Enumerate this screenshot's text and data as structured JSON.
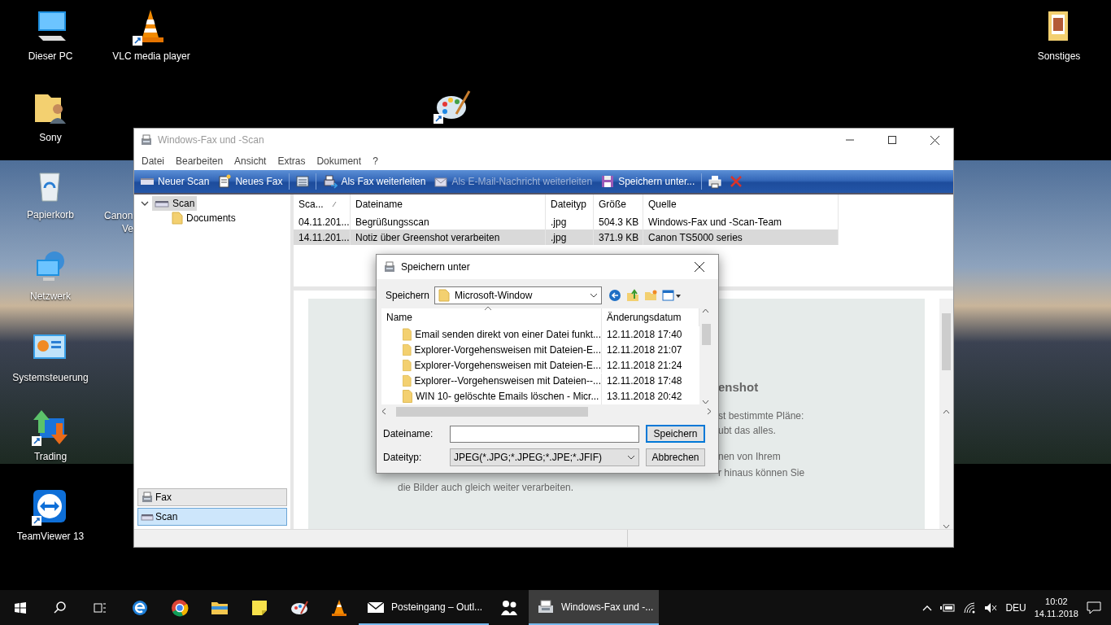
{
  "desktop": {
    "icons": [
      {
        "kind": "icon",
        "label": "Dieser PC",
        "shortcut": false
      },
      {
        "kind": "icon",
        "label": "VLC media player",
        "shortcut": true
      },
      {
        "kind": "icon",
        "label": "Sony",
        "shortcut": false
      },
      {
        "kind": "icon",
        "shortcut": true
      },
      {
        "kind": "icon",
        "label": "Papierkorb",
        "shortcut": false
      },
      {
        "kind": "cut",
        "lines": [
          "Canon",
          "Ve"
        ]
      },
      {
        "kind": "icon",
        "label": "Netzwerk",
        "shortcut": false
      },
      {
        "kind": "icon",
        "label": "Systemsteuerung",
        "shortcut": false
      },
      {
        "kind": "icon",
        "label": "Trading",
        "shortcut": true
      },
      {
        "kind": "icon",
        "label": "TeamViewer 13",
        "shortcut": true
      },
      {
        "kind": "icon",
        "label": "Sonstiges",
        "shortcut": false
      }
    ]
  },
  "window": {
    "title": "Windows-Fax und -Scan",
    "menu": [
      "Datei",
      "Bearbeiten",
      "Ansicht",
      "Extras",
      "Dokument",
      "?"
    ],
    "toolbar": [
      {
        "kind": "button",
        "label": "Neuer Scan",
        "disabled": false
      },
      {
        "kind": "button",
        "label": "Neues Fax",
        "disabled": false
      },
      {
        "kind": "separator"
      },
      {
        "kind": "icon",
        "disabled": false
      },
      {
        "kind": "separator"
      },
      {
        "kind": "button",
        "label": "Als Fax weiterleiten",
        "disabled": false
      },
      {
        "kind": "button",
        "label": "Als E-Mail-Nachricht weiterleiten",
        "disabled": true
      },
      {
        "kind": "button",
        "label": "Speichern unter...",
        "disabled": false
      },
      {
        "kind": "separator"
      },
      {
        "kind": "icon",
        "disabled": false
      },
      {
        "kind": "icon",
        "disabled": false
      }
    ],
    "tree": [
      {
        "label": "Scan",
        "expanded": true,
        "selected": true,
        "children": [
          {
            "label": "Documents"
          }
        ]
      }
    ],
    "nav_buttons": [
      {
        "label": "Fax",
        "selected": false
      },
      {
        "label": "Scan",
        "selected": true
      }
    ],
    "table": {
      "columns": [
        "Sca...",
        "Dateiname",
        "Dateityp",
        "Größe",
        "Quelle"
      ],
      "rows": [
        {
          "cells": [
            "04.11.201...",
            "Begrüßungsscan",
            ".jpg",
            "504.3 KB",
            "Windows-Fax und -Scan-Team"
          ],
          "selected": false
        },
        {
          "cells": [
            "14.11.201...",
            "Notiz über Greenshot verarbeiten",
            ".jpg",
            "371.9 KB",
            "Canon TS5000 series"
          ],
          "selected": true
        }
      ]
    },
    "preview": {
      "lines": [
        {
          "kind": "heading",
          "text": "enshot"
        },
        {
          "kind": "body",
          "text": "st bestimmte Pläne:"
        },
        {
          "kind": "body",
          "text": "ubt das alles."
        },
        {
          "kind": "body",
          "text": "nen von Ihrem"
        },
        {
          "kind": "body",
          "text": "r hinaus können Sie"
        },
        {
          "kind": "body",
          "text": "die Bilder auch gleich weiter verarbeiten."
        }
      ]
    }
  },
  "dialog": {
    "title": "Speichern unter",
    "save_in": {
      "label": "Speichern",
      "value": "Microsoft-Window"
    },
    "columns": [
      "Name",
      "Änderungsdatum"
    ],
    "rows": [
      {
        "name": "Email senden direkt von einer Datei funkt...",
        "date": "12.11.2018 17:40"
      },
      {
        "name": "Explorer-Vorgehensweisen mit Dateien-E...",
        "date": "12.11.2018 21:07"
      },
      {
        "name": "Explorer-Vorgehensweisen mit Dateien-E...",
        "date": "12.11.2018 21:24"
      },
      {
        "name": "Explorer--Vorgehensweisen mit Dateien--...",
        "date": "12.11.2018 17:48"
      },
      {
        "name": "WIN 10- gelöschte Emails löschen - Micr...",
        "date": "13.11.2018 20:42"
      }
    ],
    "filename": {
      "label": "Dateiname:"
    },
    "filetype": {
      "label": "Dateityp:",
      "value": "JPEG(*.JPG;*.JPEG;*.JPE;*.JFIF)"
    },
    "buttons": [
      {
        "label": "Speichern",
        "default": true
      },
      {
        "label": "Abbrechen",
        "default": false
      }
    ]
  },
  "taskbar": {
    "apps": [
      {
        "running": false,
        "selected": false
      },
      {
        "running": false,
        "selected": false
      },
      {
        "running": false,
        "selected": false
      },
      {
        "running": false,
        "selected": false
      },
      {
        "label": "Posteingang – Outl...",
        "running": true,
        "selected": false
      },
      {
        "running": false,
        "selected": false
      },
      {
        "label": "Windows-Fax und -...",
        "running": true,
        "selected": true
      }
    ],
    "language": "DEU",
    "time": "10:02",
    "date": "14.11.2018"
  }
}
